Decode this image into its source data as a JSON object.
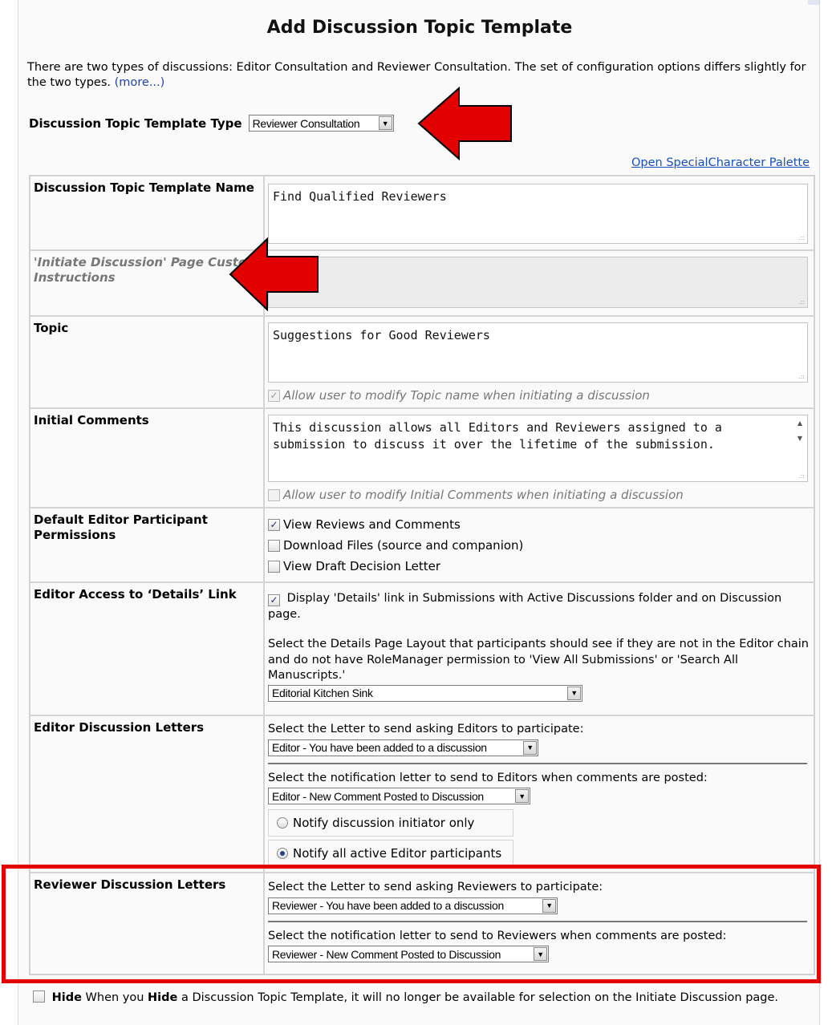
{
  "title": "Add Discussion Topic Template",
  "intro": {
    "text": "There are two types of discussions: Editor Consultation and Reviewer Consultation. The set of configuration options differs slightly for the two types.",
    "more_link": "(more...)"
  },
  "type": {
    "label": "Discussion Topic Template Type",
    "value": "Reviewer Consultation"
  },
  "palette_link": "Open SpecialCharacter Palette",
  "fields": {
    "name": {
      "label": "Discussion Topic Template Name",
      "value": "Find Qualified Reviewers"
    },
    "custom_instructions": {
      "label": "'Initiate Discussion' Page Custom Instructions",
      "value": ""
    },
    "topic": {
      "label": "Topic",
      "value": "Suggestions for Good Reviewers",
      "allow_modify_label": "Allow user to modify Topic name when initiating a discussion",
      "allow_modify_checked": true
    },
    "initial_comments": {
      "label": "Initial Comments",
      "value": "This discussion allows all Editors and Reviewers assigned to a submission to discuss it over the lifetime of the submission.",
      "allow_modify_label": "Allow user to modify Initial Comments when initiating a discussion",
      "allow_modify_checked": false
    },
    "editor_permissions": {
      "label": "Default Editor Participant Permissions",
      "options": [
        {
          "label": "View Reviews and Comments",
          "checked": true
        },
        {
          "label": "Download Files (source and companion)",
          "checked": false
        },
        {
          "label": "View Draft Decision Letter",
          "checked": false
        }
      ]
    },
    "details_link": {
      "label": "Editor Access to ‘Details’ Link",
      "display_label": "Display 'Details' link in Submissions with Active Discussions folder and on Discussion page.",
      "display_checked": true,
      "layout_instructions": "Select the Details Page Layout that participants should see if they are not in the Editor chain and do not have RoleManager permission to 'View All Submissions' or 'Search All Manuscripts.'",
      "layout_value": "Editorial Kitchen Sink"
    },
    "editor_letters": {
      "label": "Editor Discussion Letters",
      "ask_instructions": "Select the Letter to send asking Editors to participate:",
      "ask_value": "Editor - You have been added to a discussion",
      "notify_instructions": "Select the notification letter to send to Editors when comments are posted:",
      "notify_value": "Editor - New Comment Posted to Discussion",
      "radio_initiator": "Notify discussion initiator only",
      "radio_all": "Notify all active Editor participants",
      "selected_radio": "all"
    },
    "reviewer_letters": {
      "label": "Reviewer Discussion Letters",
      "ask_instructions": "Select the Letter to send asking Reviewers to participate:",
      "ask_value": "Reviewer - You have been added to a discussion",
      "notify_instructions": "Select the notification letter to send to Reviewers when comments are posted:",
      "notify_value": "Reviewer - New Comment Posted to Discussion"
    }
  },
  "hide": {
    "checkbox_label": "Hide",
    "text_prefix": "When you",
    "text_bold": "Hide",
    "text_suffix": "a Discussion Topic Template, it will no longer be available for selection on the Initiate Discussion page."
  },
  "annotation_color": "#e30000"
}
